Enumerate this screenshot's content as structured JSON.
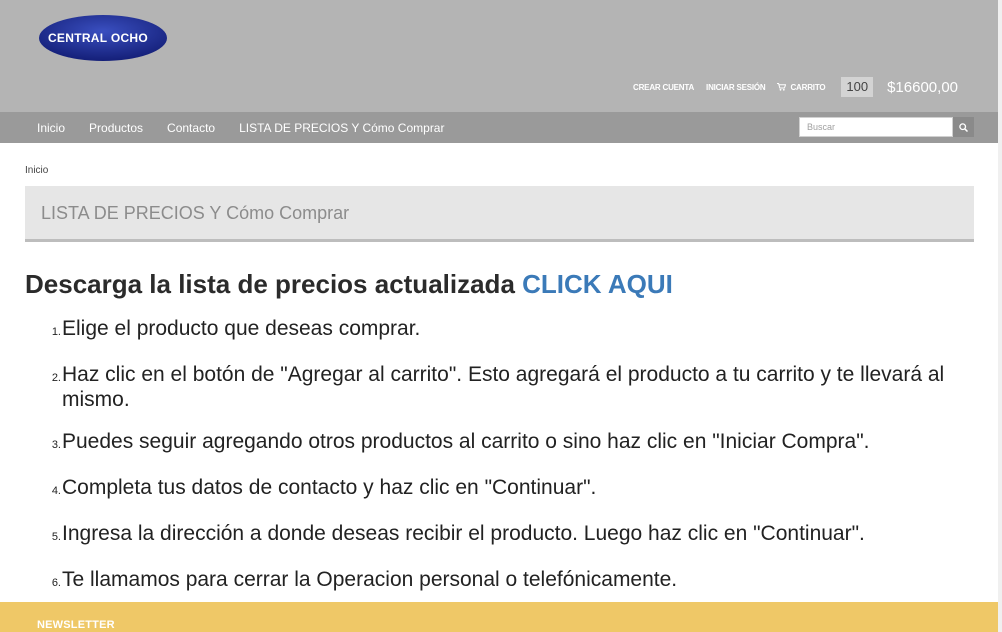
{
  "header": {
    "logo_text": "CENTRAL OCHO",
    "links": {
      "create_account": "CREAR CUENTA",
      "login": "INICIAR SESIÓN",
      "cart": "CARRITO"
    },
    "cart_count": "100",
    "cart_total": "$16600,00"
  },
  "nav": {
    "items": [
      "Inicio",
      "Productos",
      "Contacto",
      "LISTA DE PRECIOS Y Cómo Comprar"
    ],
    "search_placeholder": "Buscar"
  },
  "breadcrumb": "Inicio",
  "page_heading": "LISTA DE PRECIOS Y Cómo Comprar",
  "content": {
    "title": "Descarga la lista de precios actualizada",
    "title_link": "CLICK AQUI",
    "steps": [
      {
        "num": "1.",
        "text": "Elige el producto que deseas comprar."
      },
      {
        "num": "2.",
        "text": "Haz clic en el botón de \"Agregar al carrito\". Esto agregará el producto a tu carrito y te llevará al mismo."
      },
      {
        "num": "3.",
        "text": "Puedes seguir agregando otros productos al carrito o sino haz clic en \"Iniciar Compra\"."
      },
      {
        "num": "4.",
        "text": "Completa tus datos de contacto y haz clic en \"Continuar\"."
      },
      {
        "num": "5.",
        "text": "Ingresa la dirección a donde deseas recibir el producto. Luego haz clic en \"Continuar\"."
      },
      {
        "num": "6.",
        "text": "Te llamamos para cerrar la Operacion personal o telefónicamente."
      }
    ]
  },
  "footer": {
    "newsletter_label": "NEWSLETTER"
  },
  "colors": {
    "header_bg": "#b4b4b4",
    "nav_bg": "#9a9a9a",
    "link_blue": "#3b7ab8",
    "newsletter_bg": "#efc867",
    "logo_blue": "#1e2f8f"
  },
  "icons": {
    "cart": "cart-icon",
    "search": "search-icon"
  }
}
